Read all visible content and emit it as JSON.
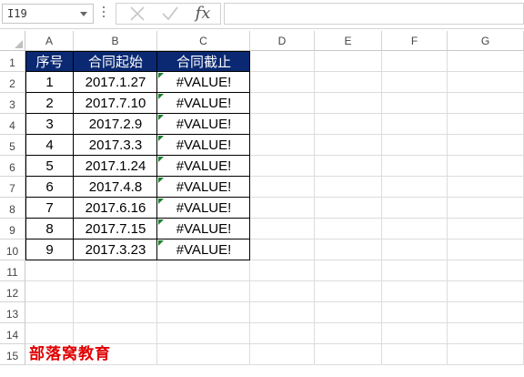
{
  "formula_bar": {
    "name_box": "I19",
    "formula": ""
  },
  "columns": [
    "A",
    "B",
    "C",
    "D",
    "E",
    "F",
    "G"
  ],
  "rows": [
    "1",
    "2",
    "3",
    "4",
    "5",
    "6",
    "7",
    "8",
    "9",
    "10",
    "11",
    "12",
    "13",
    "14",
    "15"
  ],
  "table": {
    "headers": [
      "序号",
      "合同起始",
      "合同截止"
    ],
    "rows": [
      [
        "1",
        "2017.1.27",
        "#VALUE!"
      ],
      [
        "2",
        "2017.7.10",
        "#VALUE!"
      ],
      [
        "3",
        "2017.2.9",
        "#VALUE!"
      ],
      [
        "4",
        "2017.3.3",
        "#VALUE!"
      ],
      [
        "5",
        "2017.1.24",
        "#VALUE!"
      ],
      [
        "6",
        "2017.4.8",
        "#VALUE!"
      ],
      [
        "7",
        "2017.6.16",
        "#VALUE!"
      ],
      [
        "8",
        "2017.7.15",
        "#VALUE!"
      ],
      [
        "9",
        "2017.3.23",
        "#VALUE!"
      ]
    ]
  },
  "watermark": "部落窝教育",
  "colors": {
    "header_fill": "#0a2972",
    "header_text": "#ffffff",
    "error_indicator": "#1d7f2e",
    "watermark": "#e00000"
  },
  "icons": [
    "dropdown-arrow-icon",
    "cancel-icon",
    "enter-icon",
    "function-icon"
  ]
}
